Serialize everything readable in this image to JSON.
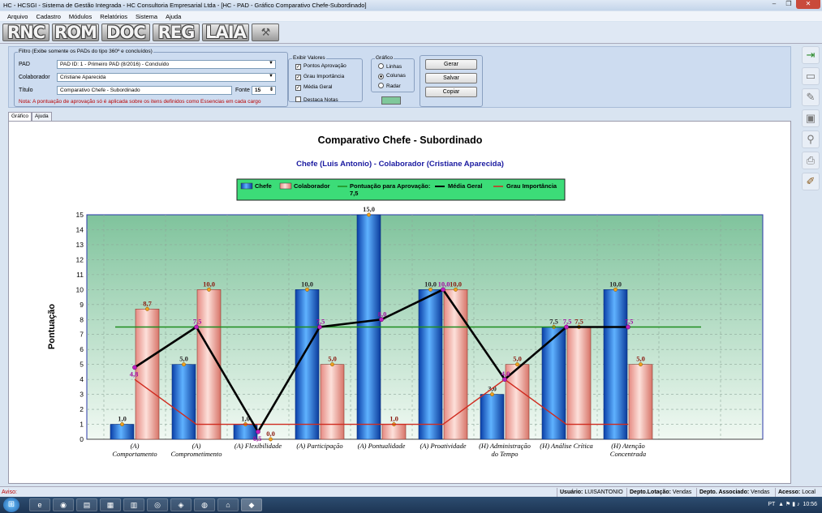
{
  "window": {
    "title": "HC - HCSGI - Sistema de Gestão Integrada - HC Consultoria Empresarial Ltda - [HC - PAD - Gráfico Comparativo Chefe-Subordinado]"
  },
  "menu": [
    "Arquivo",
    "Cadastro",
    "Módulos",
    "Relatórios",
    "Sistema",
    "Ajuda"
  ],
  "modules": [
    "RNC",
    "ROM",
    "DOC",
    "REG",
    "LAIA"
  ],
  "filter": {
    "legend": "Filtro (Exibe somente os PADs do tipo 360º e concluídos)",
    "pad_label": "PAD",
    "pad_value": "PAD ID: 1 - Primeiro PAD (8/2016) - Concluído",
    "colab_label": "Colaborador",
    "colab_value": "Cristiane Aparecida",
    "titulo_label": "Título",
    "titulo_value": "Comparativo Chefe - Subordinado",
    "fonte_label": "Fonte",
    "fonte_value": "15",
    "note": "Nota: A pontuação de aprovação só é aplicada sobre os itens definidos como Essencias em cada cargo"
  },
  "exibir": {
    "legend": "Exibir Valores",
    "items": [
      "Pontos Aprovação",
      "Grau Importância",
      "Média Geral"
    ],
    "destaca": "Destaca Notas"
  },
  "grafico": {
    "legend": "Gráfico",
    "options": [
      "Linhas",
      "Colunas",
      "Radar"
    ],
    "selected": "Colunas"
  },
  "buttons": {
    "gerar": "Gerar",
    "salvar": "Salvar",
    "copiar": "Copiar"
  },
  "tabs": [
    "Gráfico",
    "Ajuda"
  ],
  "chart_data": {
    "type": "bar",
    "title": "Comparativo Chefe - Subordinado",
    "subtitle": "Chefe (Luis Antonio) - Colaborador (Cristiane Aparecida)",
    "ylabel": "Pontuação",
    "ylim": [
      0,
      15
    ],
    "yticks": [
      0,
      1,
      2,
      3,
      4,
      5,
      6,
      7,
      8,
      9,
      10,
      11,
      12,
      13,
      14,
      15
    ],
    "categories": [
      "(A) Comportamento",
      "(A) Comprometimento",
      "(A) Flexibilidade",
      "(A) Participação",
      "(A) Pontualidade",
      "(A) Proatividade",
      "(H) Administração do Tempo",
      "(H) Análise Crítica",
      "(H) Atenção Concentrada"
    ],
    "category_lines": [
      [
        "(A)",
        "Comportamento"
      ],
      [
        "(A)",
        "Comprometimento"
      ],
      [
        "(A) Flexibilidade"
      ],
      [
        "(A) Participação"
      ],
      [
        "(A) Pontualidade"
      ],
      [
        "(A) Proatividade"
      ],
      [
        "(H) Administração",
        "do Tempo"
      ],
      [
        "(H) Análise Crítica"
      ],
      [
        "(H) Atenção",
        "Concentrada"
      ]
    ],
    "series": [
      {
        "name": "Chefe",
        "type": "bar",
        "color": "#1f6fe0",
        "values": [
          1.0,
          5.0,
          1.0,
          10.0,
          15.0,
          10.0,
          3.0,
          7.5,
          10.0
        ],
        "labels": [
          "1,0",
          "5,0",
          "1,0",
          "10,0",
          "15,0",
          "10,0",
          "3,0",
          "7,5",
          "10,0"
        ]
      },
      {
        "name": "Colaborador",
        "type": "bar",
        "color": "#f4a49c",
        "values": [
          8.7,
          10.0,
          0.0,
          5.0,
          1.0,
          10.0,
          5.0,
          7.5,
          5.0
        ],
        "labels": [
          "8,7",
          "10,0",
          "0,0",
          "5,0",
          "1,0",
          "10,0",
          "5,0",
          "7,5",
          "5,0"
        ]
      },
      {
        "name": "Pontuação para Aprovação: 7,5",
        "type": "line",
        "color": "#1e8c1e",
        "value": 7.5
      },
      {
        "name": "Média Geral",
        "type": "line",
        "color": "#000000",
        "values": [
          4.8,
          7.5,
          0.5,
          7.5,
          8.0,
          10.0,
          4.0,
          7.5,
          7.5
        ],
        "labels": [
          "4,8",
          "7,5",
          "0,5",
          "7,5",
          "8,0",
          "10,0",
          "4,0",
          "7,5",
          "7,5"
        ]
      },
      {
        "name": "Grau Importância",
        "type": "line",
        "color": "#d02a1e",
        "values": [
          4,
          1,
          1,
          1,
          1,
          1,
          4,
          1,
          1
        ]
      }
    ],
    "grid": true,
    "legend_position": "top"
  },
  "status": {
    "aviso": "Aviso:",
    "usuario_label": "Usuário:",
    "usuario": "LUISANTONIO",
    "lotacao_label": "Depto.Lotação:",
    "lotacao": "Vendas",
    "associado_label": "Depto. Associado:",
    "associado": "Vendas",
    "acesso_label": "Acesso:",
    "acesso": "Local"
  },
  "taskbar": {
    "lang": "PT",
    "time": "10:56"
  }
}
